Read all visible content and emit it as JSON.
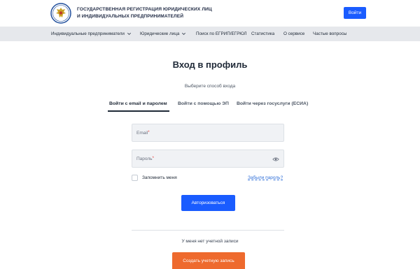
{
  "header": {
    "brand_line1": "ГОСУДАРСТВЕННАЯ РЕГИСТРАЦИЯ ЮРИДИЧЕСКИХ ЛИЦ",
    "brand_line2": "И ИНДИВИДУАЛЬНЫХ ПРЕДПРИНИМАТЕЛЕЙ",
    "login_label": "Войти",
    "logo_icon": "eagle-emblem-icon"
  },
  "nav": {
    "items": [
      {
        "label": "Индивидуальные предприниматели",
        "dropdown": true
      },
      {
        "label": "Юридические лица",
        "dropdown": true
      },
      {
        "label": "Поиск по ЕГРИП/ЕГРЮЛ",
        "dropdown": false
      },
      {
        "label": "Статистика",
        "dropdown": false
      },
      {
        "label": "О сервисе",
        "dropdown": false
      },
      {
        "label": "Частые вопросы",
        "dropdown": false
      }
    ]
  },
  "main": {
    "title": "Вход в профиль",
    "subtitle": "Выберите способ входа",
    "tabs": [
      {
        "label": "Войти с email и паролем",
        "active": true
      },
      {
        "label": "Войти с помощью ЭП",
        "active": false
      },
      {
        "label": "Войти через госуслуги (ЕСИА)",
        "active": false
      }
    ],
    "email_label": "Email",
    "password_label": "Пароль",
    "required_mark": "*",
    "remember_label": "Запомнить меня",
    "forgot_label": "Забыли пароль?",
    "submit_label": "Авторизоваться",
    "no_account_text": "У меня нет учетной записи",
    "create_label": "Создать учетную запись"
  },
  "colors": {
    "primary": "#1a5cff",
    "accent": "#ee6a2e",
    "nav_bg": "#e6e8ec",
    "link": "#2f6fd8",
    "required": "#e53935"
  }
}
